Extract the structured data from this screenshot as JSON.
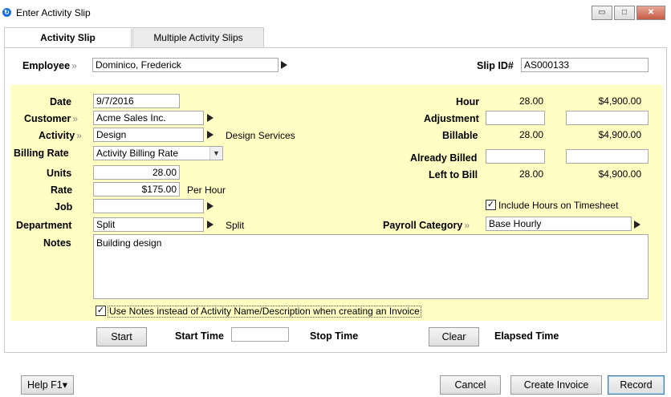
{
  "window": {
    "title": "Enter Activity Slip",
    "minimize_glyph": "▭",
    "maximize_glyph": "□",
    "close_glyph": "✕"
  },
  "tabs": [
    {
      "label": "Activity Slip",
      "active": true
    },
    {
      "label": "Multiple Activity Slips",
      "active": false
    }
  ],
  "header": {
    "employee_label": "Employee",
    "employee_value": "Dominico, Frederick",
    "slip_id_label": "Slip ID#",
    "slip_id_value": "AS000133"
  },
  "form": {
    "date_label": "Date",
    "date_value": "9/7/2016",
    "customer_label": "Customer",
    "customer_value": "Acme Sales Inc.",
    "activity_label": "Activity",
    "activity_value": "Design",
    "activity_description": "Design Services",
    "billing_rate_label": "Billing Rate",
    "billing_rate_value": "Activity Billing Rate",
    "units_label": "Units",
    "units_value": "28.00",
    "rate_label": "Rate",
    "rate_value": "$175.00",
    "rate_unit": "Per Hour",
    "job_label": "Job",
    "job_value": "",
    "department_label": "Department",
    "department_value": "Split",
    "department_description": "Split",
    "payroll_category_label": "Payroll Category",
    "payroll_category_value": "Base Hourly",
    "notes_label": "Notes",
    "notes_value": "Building design",
    "use_notes_checkbox_label": "Use Notes instead of Activity Name/Description when creating an Invoice",
    "use_notes_checked": true,
    "include_hours_label": "Include Hours on Timesheet",
    "include_hours_checked": true
  },
  "summary": {
    "hour_label": "Hour",
    "hour_units": "28.00",
    "hour_amount": "$4,900.00",
    "adjustment_label": "Adjustment",
    "adjustment_units": "",
    "adjustment_amount": "",
    "billable_label": "Billable",
    "billable_units": "28.00",
    "billable_amount": "$4,900.00",
    "already_billed_label": "Already Billed",
    "already_billed_units": "",
    "already_billed_amount": "",
    "left_to_bill_label": "Left to Bill",
    "left_to_bill_units": "28.00",
    "left_to_bill_amount": "$4,900.00"
  },
  "timer": {
    "start_button": "Start",
    "start_time_label": "Start Time",
    "start_time_value": "",
    "stop_time_label": "Stop Time",
    "clear_button": "Clear",
    "elapsed_time_label": "Elapsed Time"
  },
  "footer": {
    "help_button": "Help F1",
    "cancel_button": "Cancel",
    "create_invoice_button": "Create Invoice",
    "record_button": "Record"
  },
  "glyphs": {
    "chevron": "»",
    "check": "✓",
    "dropdown": "▼",
    "help_dropdown": "▾"
  }
}
